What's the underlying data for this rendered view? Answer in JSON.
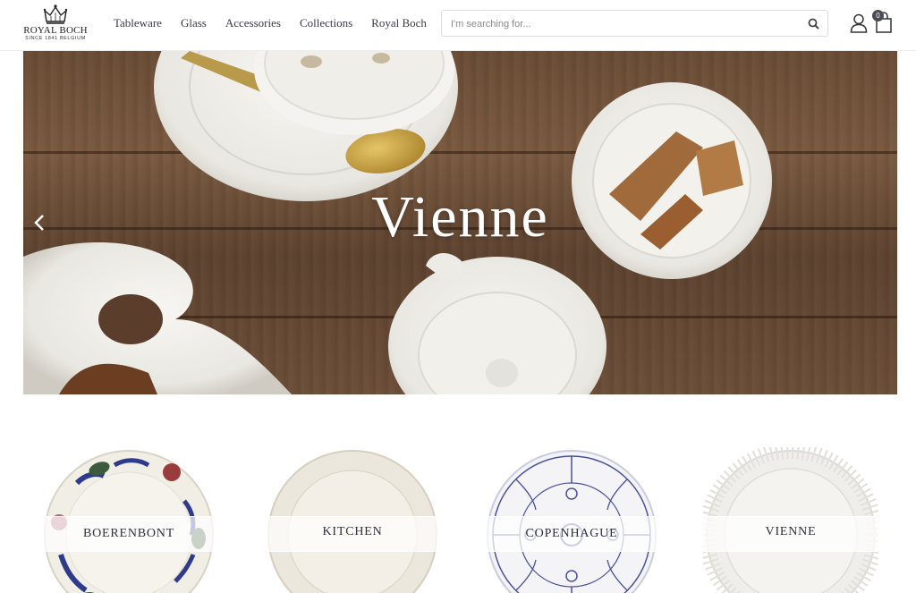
{
  "brand": {
    "name": "ROYAL BOCH",
    "tagline": "SINCE 1841 BELGIUM",
    "logo_icon": "crown-icon"
  },
  "nav": {
    "items": [
      {
        "label": "Tableware"
      },
      {
        "label": "Glass"
      },
      {
        "label": "Accessories"
      },
      {
        "label": "Collections"
      },
      {
        "label": "Royal Boch"
      }
    ]
  },
  "search": {
    "placeholder": "I'm searching for...",
    "value": "",
    "icon": "search-icon"
  },
  "account": {
    "icon": "user-icon"
  },
  "cart": {
    "icon": "shopping-bag-icon",
    "count": "0"
  },
  "hero": {
    "title": "Vienne",
    "prev_icon": "chevron-left-icon"
  },
  "categories": [
    {
      "label": "BOERENBONT"
    },
    {
      "label": "KITCHEN"
    },
    {
      "label": "COPENHAGUE"
    },
    {
      "label": "VIENNE"
    }
  ],
  "colors": {
    "text_dark": "#3a3a4a",
    "badge": "#4a4a55",
    "wood": "#6b4d36",
    "porcelain": "#efeeea",
    "copenhague_blue": "#4a4f9c",
    "boerenbont_blue": "#2e3b8c"
  }
}
